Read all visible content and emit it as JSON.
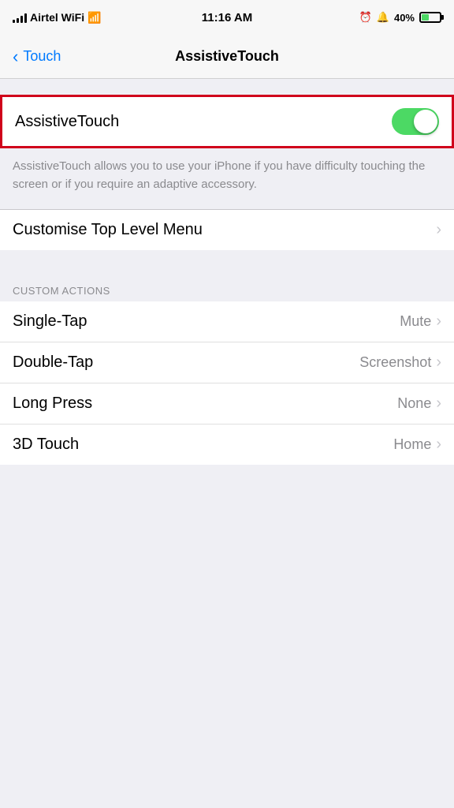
{
  "statusBar": {
    "carrier": "Airtel WiFi",
    "time": "11:16 AM",
    "batteryPercent": "40%"
  },
  "navBar": {
    "backLabel": "Touch",
    "title": "AssistiveTouch"
  },
  "assistiveTouchRow": {
    "label": "AssistiveTouch",
    "toggleOn": true
  },
  "description": {
    "text": "AssistiveTouch allows you to use your iPhone if you have difficulty touching the screen or if you require an adaptive accessory."
  },
  "customiseMenu": {
    "label": "Customise Top Level Menu"
  },
  "customActionsSection": {
    "header": "CUSTOM ACTIONS",
    "rows": [
      {
        "label": "Single-Tap",
        "value": "Mute"
      },
      {
        "label": "Double-Tap",
        "value": "Screenshot"
      },
      {
        "label": "Long Press",
        "value": "None"
      },
      {
        "label": "3D Touch",
        "value": "Home"
      }
    ]
  }
}
